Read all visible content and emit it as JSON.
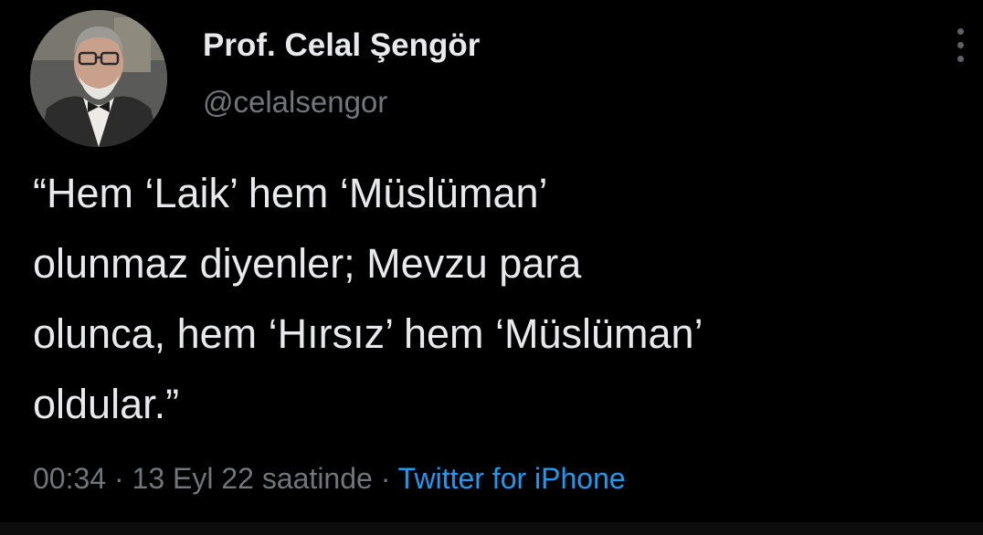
{
  "author": {
    "display_name": "Prof. Celal Şengör",
    "handle": "@celalsengor",
    "avatar_icon": "profile-photo"
  },
  "tweet": {
    "text": "“Hem ‘Laik’ hem ‘Müslüman’\nolunmaz diyenler; Mevzu para\nolunca, hem ‘Hırsız’ hem ‘Müslüman’\noldular.”",
    "time": "00:34",
    "separator": " · ",
    "date": "13 Eyl 22 saatinde",
    "source": "Twitter for iPhone"
  },
  "actions": {
    "more_icon": "vertical-ellipsis-icon"
  },
  "colors": {
    "background": "#000000",
    "primary_text": "#e7e9ea",
    "secondary_text": "#71767b",
    "link": "#1d9bf0"
  }
}
